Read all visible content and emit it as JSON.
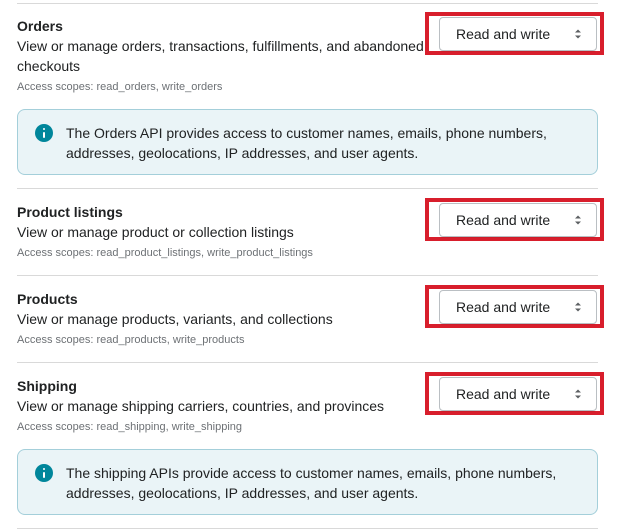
{
  "sections": [
    {
      "title": "Orders",
      "description": "View or manage orders, transactions, fulfillments, and abandoned checkouts",
      "scopes": "Access scopes: read_orders, write_orders",
      "access": "Read and write"
    },
    {
      "title": "Product listings",
      "description": "View or manage product or collection listings",
      "scopes": "Access scopes: read_product_listings, write_product_listings",
      "access": "Read and write"
    },
    {
      "title": "Products",
      "description": "View or manage products, variants, and collections",
      "scopes": "Access scopes: read_products, write_products",
      "access": "Read and write"
    },
    {
      "title": "Shipping",
      "description": "View or manage shipping carriers, countries, and provinces",
      "scopes": "Access scopes: read_shipping, write_shipping",
      "access": "Read and write"
    }
  ],
  "banners": {
    "orders": "The Orders API provides access to customer names, emails, phone numbers, addresses, geolocations, IP addresses, and user agents.",
    "shipping": "The shipping APIs provide access to customer names, emails, phone numbers, addresses, geolocations, IP addresses, and user agents."
  },
  "icons": {
    "select_chevron": "select-chevron-icon",
    "info": "info-icon"
  },
  "colors": {
    "highlight_border": "#d81e2c",
    "banner_background": "#eaf4f7",
    "banner_border": "#a4cfda",
    "info_icon": "#00869b"
  }
}
